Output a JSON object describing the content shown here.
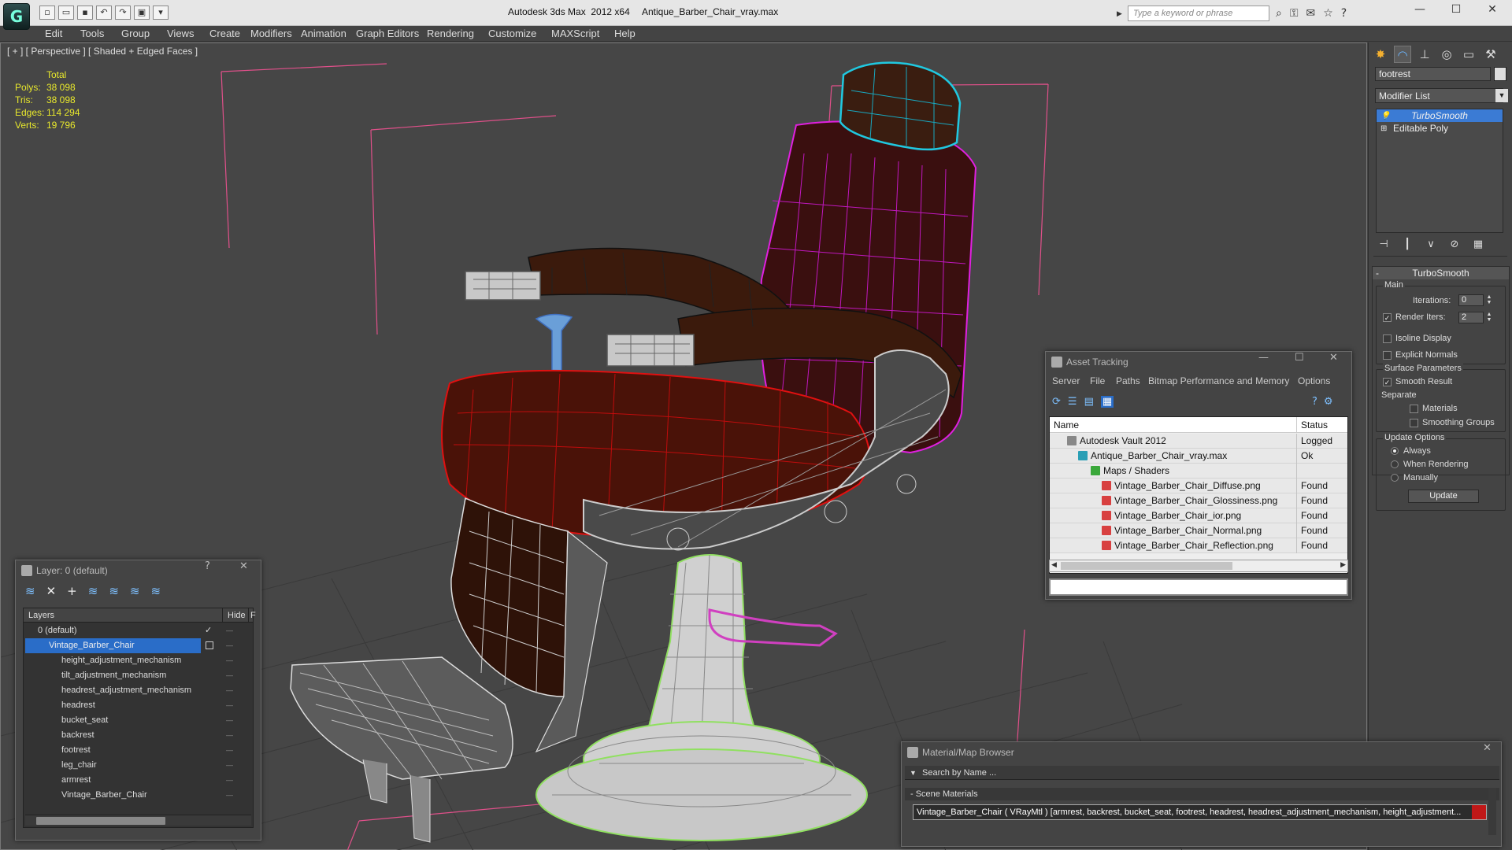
{
  "app": {
    "title": "Autodesk 3ds Max  2012 x64",
    "filename": "Antique_Barber_Chair_vray.max",
    "logo": "3ds-max-logo",
    "search_placeholder": "Type a keyword or phrase"
  },
  "menu": [
    "Edit",
    "Tools",
    "Group",
    "Views",
    "Create",
    "Modifiers",
    "Animation",
    "Graph Editors",
    "Rendering",
    "Customize",
    "MAXScript",
    "Help"
  ],
  "viewport": {
    "label": "[ + ] [ Perspective ] [ Shaded + Edged Faces ]",
    "stats": {
      "header": "Total",
      "rows": [
        {
          "k": "Polys:",
          "v": "38 098"
        },
        {
          "k": "Tris:",
          "v": "38 098"
        },
        {
          "k": "Edges:",
          "v": "114 294"
        },
        {
          "k": "Verts:",
          "v": "19 796"
        }
      ]
    }
  },
  "command_panel": {
    "object_name": "footrest",
    "modifier_list": "Modifier List",
    "stack": [
      "TurboSmooth",
      "Editable Poly"
    ],
    "rollout": {
      "title": "TurboSmooth",
      "main_label": "Main",
      "iterations_label": "Iterations:",
      "iterations_value": "0",
      "render_iters_label": "Render Iters:",
      "render_iters_value": "2",
      "isoline": "Isoline Display",
      "explicit": "Explicit Normals",
      "surface_label": "Surface Parameters",
      "smooth_result": "Smooth Result",
      "separate_label": "Separate",
      "materials": "Materials",
      "smoothing_groups": "Smoothing Groups",
      "update_label": "Update Options",
      "always": "Always",
      "when_rendering": "When Rendering",
      "manually": "Manually",
      "update_button": "Update"
    }
  },
  "layer_dialog": {
    "title": "Layer: 0 (default)",
    "col_layers": "Layers",
    "col_hide": "Hide",
    "col_f": "F",
    "rows": [
      {
        "name": "0 (default)",
        "level": 0
      },
      {
        "name": "Vintage_Barber_Chair",
        "level": 0
      },
      {
        "name": "height_adjustment_mechanism",
        "level": 1
      },
      {
        "name": "tilt_adjustment_mechanism",
        "level": 1
      },
      {
        "name": "headrest_adjustment_mechanism",
        "level": 1
      },
      {
        "name": "headrest",
        "level": 1
      },
      {
        "name": "bucket_seat",
        "level": 1
      },
      {
        "name": "backrest",
        "level": 1
      },
      {
        "name": "footrest",
        "level": 1
      },
      {
        "name": "leg_chair",
        "level": 1
      },
      {
        "name": "armrest",
        "level": 1
      },
      {
        "name": "Vintage_Barber_Chair",
        "level": 1
      }
    ]
  },
  "asset_dialog": {
    "title": "Asset Tracking",
    "menu": [
      "Server",
      "File",
      "Paths",
      "Bitmap Performance and Memory",
      "Options"
    ],
    "col_name": "Name",
    "col_status": "Status",
    "rows": [
      {
        "name": "Autodesk Vault 2012",
        "status": "Logged Out ..."
      },
      {
        "name": "Antique_Barber_Chair_vray.max",
        "status": "Ok"
      },
      {
        "name": "Maps / Shaders",
        "status": ""
      },
      {
        "name": "Vintage_Barber_Chair_Diffuse.png",
        "status": "Found"
      },
      {
        "name": "Vintage_Barber_Chair_Glossiness.png",
        "status": "Found"
      },
      {
        "name": "Vintage_Barber_Chair_ior.png",
        "status": "Found"
      },
      {
        "name": "Vintage_Barber_Chair_Normal.png",
        "status": "Found"
      },
      {
        "name": "Vintage_Barber_Chair_Reflection.png",
        "status": "Found"
      }
    ]
  },
  "material_browser": {
    "title": "Material/Map Browser",
    "search": "Search by Name ...",
    "group": "- Scene Materials",
    "item": "Vintage_Barber_Chair  ( VRayMtl ) [armrest, backrest, bucket_seat, footrest, headrest, headrest_adjustment_mechanism, height_adjustment..."
  },
  "colors": {
    "viewport_bg": "#464646",
    "selection_blue": "#2a6dc8",
    "stats_yellow": "#e8e82c",
    "wire_magenta": "#e020e0",
    "wire_red": "#e01010",
    "wire_cyan": "#20c8e0",
    "wire_green": "#90e060"
  }
}
